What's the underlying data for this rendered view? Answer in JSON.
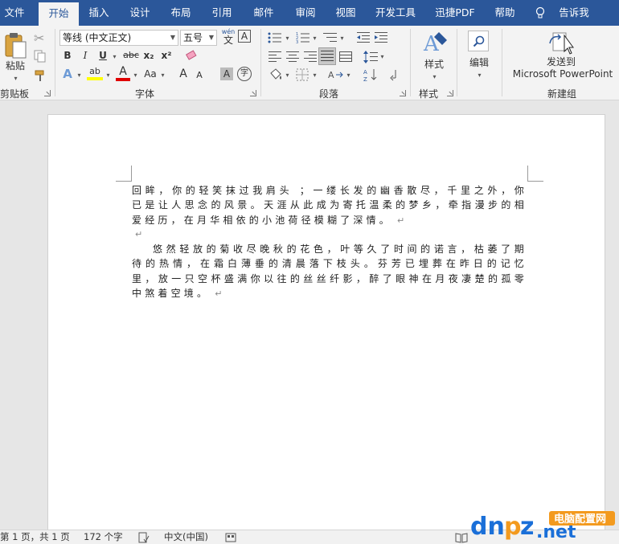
{
  "tabs": [
    "文件",
    "开始",
    "插入",
    "设计",
    "布局",
    "引用",
    "邮件",
    "审阅",
    "视图",
    "开发工具",
    "迅捷PDF",
    "帮助"
  ],
  "tell_me": "告诉我",
  "ribbon": {
    "clipboard": {
      "paste": "粘贴",
      "group": "剪贴板"
    },
    "font": {
      "font_name": "等线 (中文正文)",
      "font_size": "五号",
      "wen_label": "wén",
      "bold": "B",
      "italic": "I",
      "underline": "U",
      "strike": "abc",
      "sub": "x₂",
      "sup": "x²",
      "text_effect": "A",
      "highlight": "ab",
      "font_color": "A",
      "change_case": "Aa",
      "grow": "A",
      "shrink": "A",
      "shade": "A",
      "enclose": "字",
      "group": "字体"
    },
    "paragraph": {
      "group": "段落"
    },
    "styles": {
      "label": "样式",
      "group": "样式"
    },
    "editing": {
      "label": "编辑"
    },
    "new_group": {
      "line1": "发送到",
      "line2": "Microsoft PowerPoint",
      "group": "新建组"
    }
  },
  "document": {
    "paragraph1": "回眸，你的轻笑抹过我肩头 ；一缕长发的幽香散尽，千里之外，你已是让人思念的风景。天涯从此成为寄托温柔的梦乡，牵指漫步的相爱经历，在月华相依的小池荷径模糊了深情。",
    "paragraph2": "悠然轻放的菊收尽晚秋的花色，叶等久了时间的诺言，枯萎了期待的热情，在霜白薄垂的清晨落下枝头。芬芳已埋葬在昨日的记忆里，放一只空杯盛满你以往的丝丝纤影，醉了眼神在月夜凄楚的孤零中煞着空境。",
    "para_mark": "↵"
  },
  "status": {
    "page": "第 1 页，共 1 页",
    "words": "172 个字",
    "language": "中文(中国)"
  },
  "watermark": {
    "brand": "dnpz.net",
    "cn": "电脑配置网"
  },
  "colors": {
    "accent": "#2b579a",
    "highlight": "#ffff00",
    "font_color": "#e00000",
    "watermark_blue": "#1a6fd8",
    "watermark_orange": "#f39a1e"
  }
}
